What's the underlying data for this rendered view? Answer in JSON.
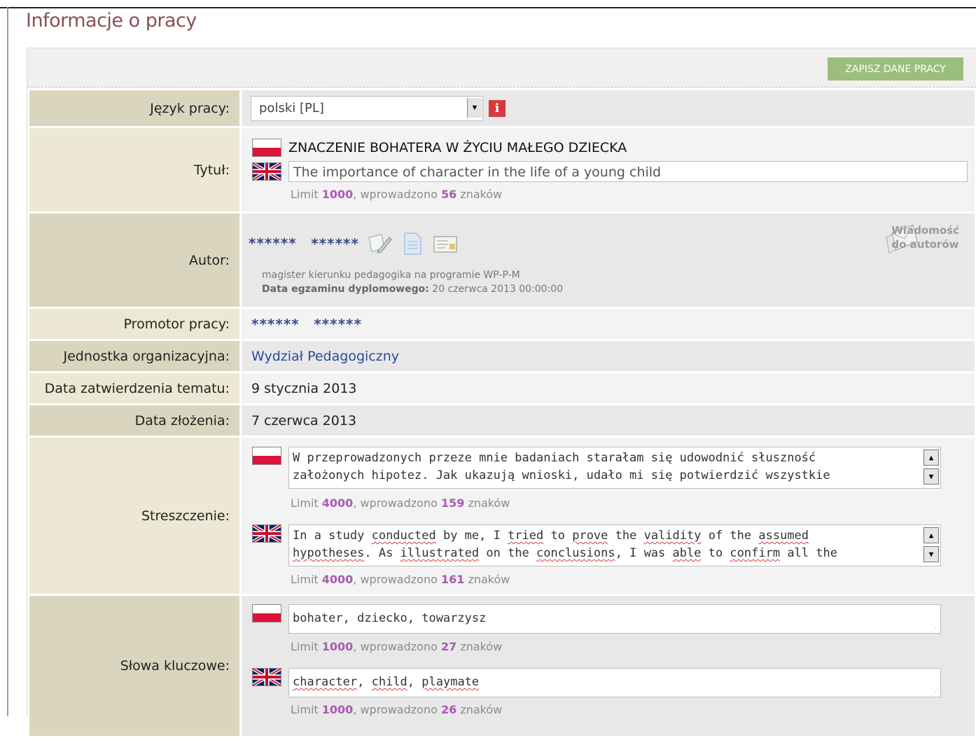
{
  "page": {
    "title": "Informacje o pracy"
  },
  "toolbar": {
    "save_label": "ZAPISZ DANE PRACY"
  },
  "language": {
    "label": "Język pracy:",
    "value": "polski [PL]"
  },
  "title": {
    "label": "Tytuł:",
    "pl": "ZNACZENIE BOHATERA W ŻYCIU MAŁEGO DZIECKA",
    "en": "The importance of character in the life of a young child",
    "limit_prefix": "Limit ",
    "limit": "1000",
    "entered_prefix": ", wprowadzono ",
    "entered": "56",
    "suffix": " znaków"
  },
  "author": {
    "label": "Autor:",
    "first": "******",
    "last": "******",
    "program": "magister kierunku pedagogika na programie WP-P-M",
    "exam_label": "Data egzaminu dyplomowego:",
    "exam_date": " 20 czerwca 2013 00:00:00",
    "message_line1": "Wiadomość",
    "message_line2": "do autorów"
  },
  "promoter": {
    "label": "Promotor pracy:",
    "first": "******",
    "last": "******"
  },
  "unit": {
    "label": "Jednostka organizacyjna:",
    "value": "Wydział Pedagogiczny"
  },
  "approval": {
    "label": "Data zatwierdzenia tematu:",
    "value": "9 stycznia 2013"
  },
  "submission": {
    "label": "Data złożenia:",
    "value": "7 czerwca 2013"
  },
  "abstract": {
    "label": "Streszczenie:",
    "pl_line1": "W przeprowadzonych przeze mnie badaniach starałam się udowodnić słuszność",
    "pl_line2": "założonych hipotez. Jak ukazują wnioski, udało mi się potwierdzić wszystkie",
    "pl_limit": "4000",
    "pl_entered": "159",
    "en_line1_a": "In a study ",
    "en_w1": "conducted",
    "en_line1_b": " by me, I ",
    "en_w2": "tried",
    "en_line1_c": " to ",
    "en_w3": "prove",
    "en_line1_d": " the ",
    "en_w4": "validity",
    "en_line1_e": " of the ",
    "en_w5": "assumed",
    "en_w6": "hypotheses",
    "en_line2_a": ". As ",
    "en_w7": "illustrated",
    "en_line2_b": " on the ",
    "en_w8": "conclusions",
    "en_line2_c": ", I was ",
    "en_w9": "able",
    "en_line2_d": " to ",
    "en_w10": "confirm",
    "en_line2_e": " all the",
    "en_limit": "4000",
    "en_entered": "161"
  },
  "keywords": {
    "label": "Słowa kluczowe:",
    "pl": "bohater, dziecko, towarzysz",
    "pl_limit": "1000",
    "pl_entered": "27",
    "en_w1": "character",
    "en_sep1": ", ",
    "en_w2": "child",
    "en_sep2": ", ",
    "en_w3": "playmate",
    "en_limit": "1000",
    "en_entered": "26"
  },
  "icons": {
    "edit": "edit-pencil-icon",
    "document": "document-icon",
    "card": "id-card-icon",
    "envelope": "envelopes-icon",
    "info": "info-icon",
    "dropdown": "dropdown-arrow-icon"
  },
  "colors": {
    "accent": "#8a4f55",
    "save_button": "#9cbe7c",
    "label_bg": "#d9d5bf",
    "link": "#2a4a9a",
    "count": "#a85bb0"
  }
}
